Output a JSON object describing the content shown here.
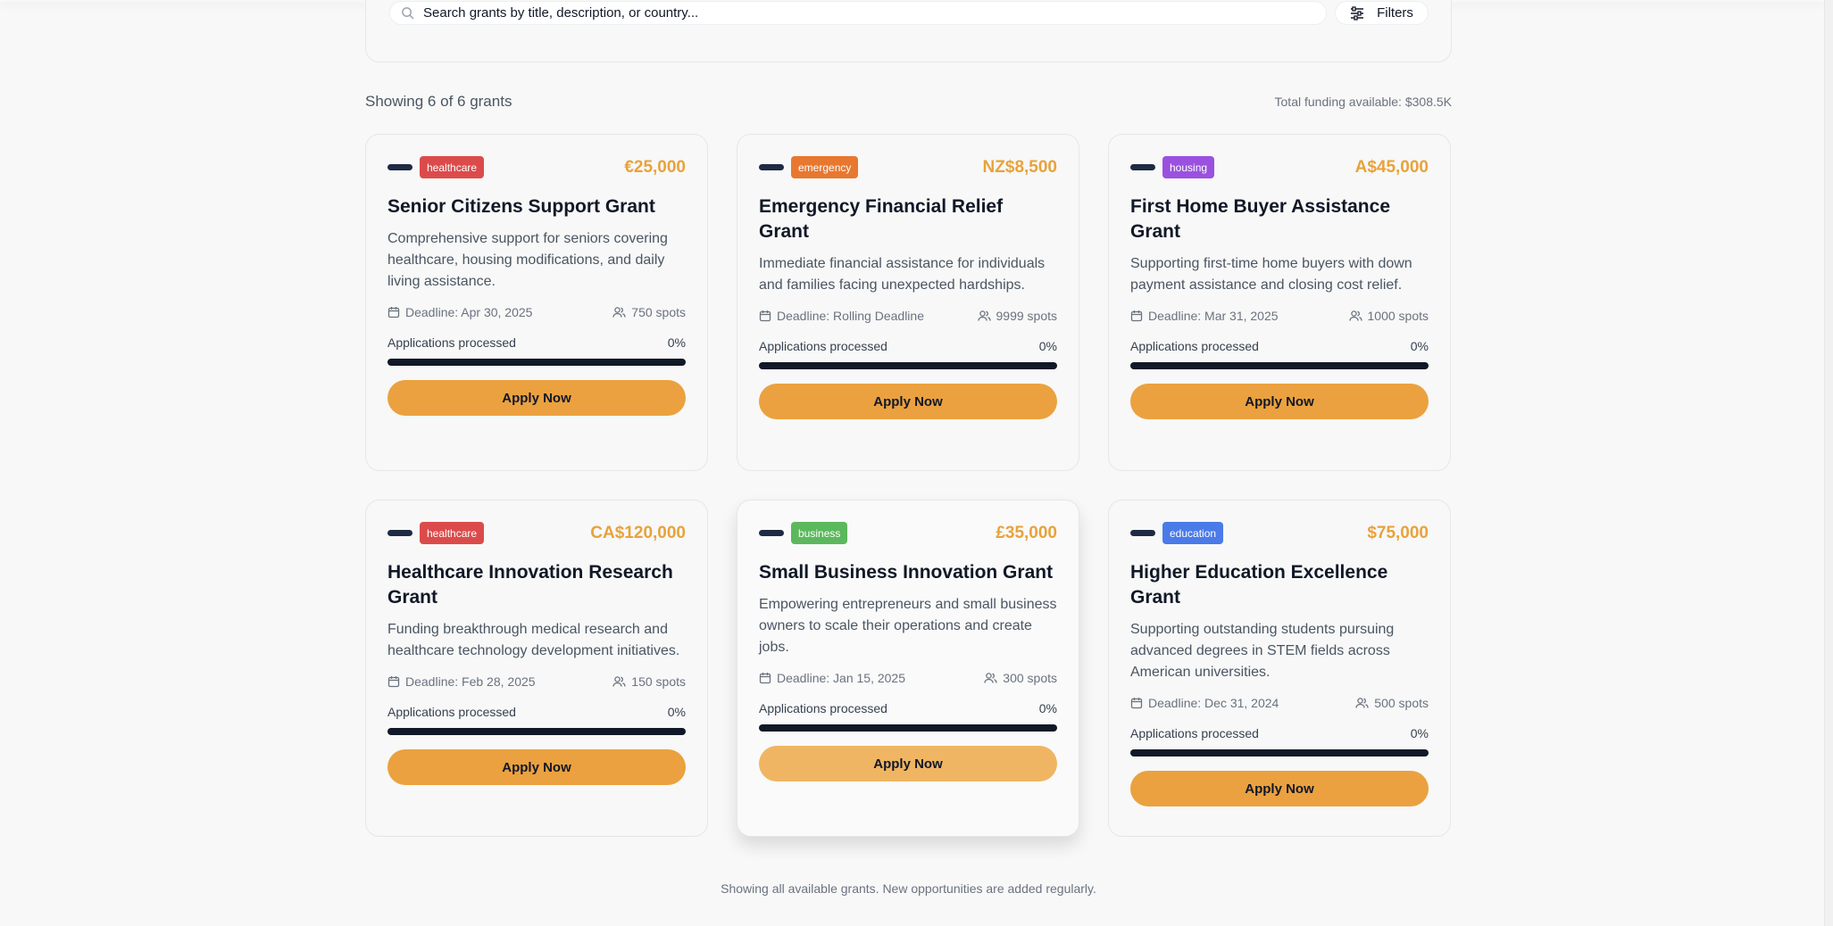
{
  "search": {
    "placeholder": "Search grants by title, description, or country...",
    "filters_label": "Filters"
  },
  "summary": {
    "showing": "Showing 6 of 6 grants",
    "total_funding": "Total funding available: $308.5K"
  },
  "colors": {
    "accent": "#eba13f",
    "amount": "#e9a23b",
    "healthcare": "#dc4b4b",
    "emergency": "#e8782f",
    "housing": "#9b51e0",
    "business": "#5cb85c",
    "education": "#4a7be8"
  },
  "grants": [
    {
      "category": "healthcare",
      "amount": "€25,000",
      "title": "Senior Citizens Support Grant",
      "description": "Comprehensive support for seniors covering healthcare, housing modifications, and daily living assistance.",
      "deadline": "Deadline: Apr 30, 2025",
      "spots": "750 spots",
      "progress_label": "Applications processed",
      "progress_value": "0%",
      "progress_fraction": 0,
      "apply_label": "Apply Now"
    },
    {
      "category": "emergency",
      "amount": "NZ$8,500",
      "title": "Emergency Financial Relief Grant",
      "description": "Immediate financial assistance for individuals and families facing unexpected hardships.",
      "deadline": "Deadline: Rolling Deadline",
      "spots": "9999 spots",
      "progress_label": "Applications processed",
      "progress_value": "0%",
      "progress_fraction": 0,
      "apply_label": "Apply Now"
    },
    {
      "category": "housing",
      "amount": "A$45,000",
      "title": "First Home Buyer Assistance Grant",
      "description": "Supporting first-time home buyers with down payment assistance and closing cost relief.",
      "deadline": "Deadline: Mar 31, 2025",
      "spots": "1000 spots",
      "progress_label": "Applications processed",
      "progress_value": "0%",
      "progress_fraction": 0,
      "apply_label": "Apply Now"
    },
    {
      "category": "healthcare",
      "amount": "CA$120,000",
      "title": "Healthcare Innovation Research Grant",
      "description": "Funding breakthrough medical research and healthcare technology development initiatives.",
      "deadline": "Deadline: Feb 28, 2025",
      "spots": "150 spots",
      "progress_label": "Applications processed",
      "progress_value": "0%",
      "progress_fraction": 0,
      "apply_label": "Apply Now"
    },
    {
      "category": "business",
      "amount": "£35,000",
      "title": "Small Business Innovation Grant",
      "description": "Empowering entrepreneurs and small business owners to scale their operations and create jobs.",
      "deadline": "Deadline: Jan 15, 2025",
      "spots": "300 spots",
      "progress_label": "Applications processed",
      "progress_value": "0%",
      "progress_fraction": 0,
      "apply_label": "Apply Now"
    },
    {
      "category": "education",
      "amount": "$75,000",
      "title": "Higher Education Excellence Grant",
      "description": "Supporting outstanding students pursuing advanced degrees in STEM fields across American universities.",
      "deadline": "Deadline: Dec 31, 2024",
      "spots": "500 spots",
      "progress_label": "Applications processed",
      "progress_value": "0%",
      "progress_fraction": 0,
      "apply_label": "Apply Now"
    }
  ],
  "footer": {
    "note": "Showing all available grants. New opportunities are added regularly."
  }
}
